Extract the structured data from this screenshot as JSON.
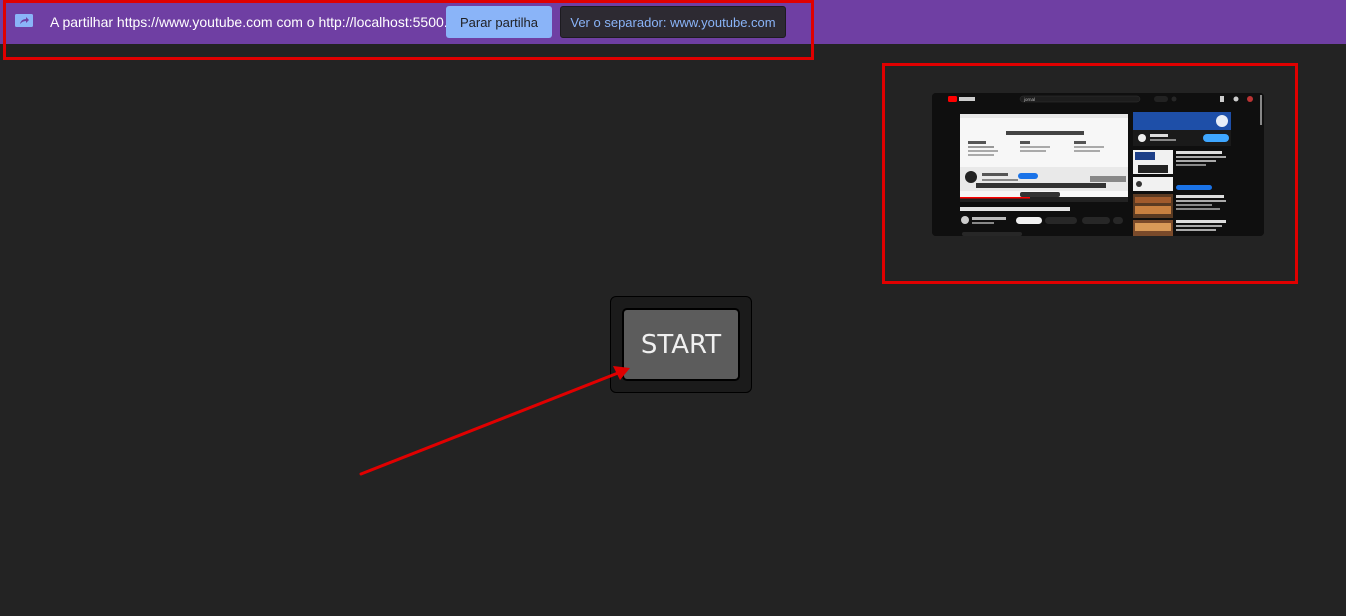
{
  "share_bar": {
    "text": "A partilhar https://www.youtube.com com o http://localhost:5500...",
    "stop_label": "Parar partilha",
    "view_label": "Ver o separador: www.youtube.com",
    "icon": "screen-share-icon",
    "background_color": "#6f3fa3"
  },
  "preview": {
    "description_icon": "shared-tab-preview",
    "search_text": "jornal"
  },
  "main": {
    "start_label": "START"
  },
  "annotation_color": "#e00000"
}
